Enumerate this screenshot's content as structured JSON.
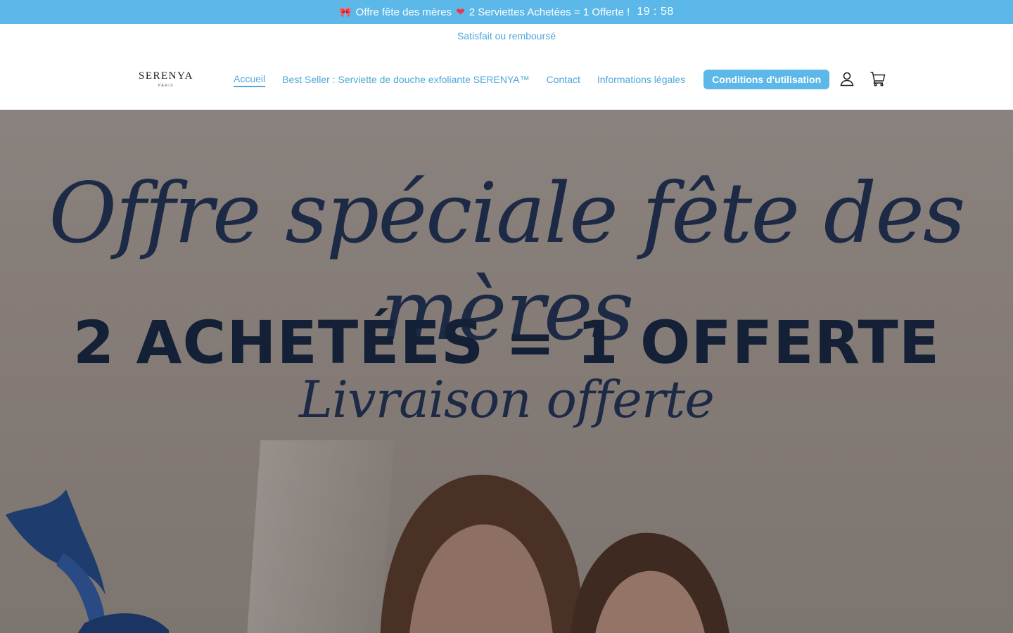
{
  "announcement": {
    "text_before": "Offre fête des mères",
    "text_after": " 2 Serviettes Achetées = 1 Offerte !",
    "timer": "19 : 58",
    "bow_icon": "ribbon-icon",
    "heart_icon": "heart-icon"
  },
  "sub_announcement": "Satisfait ou remboursé",
  "header": {
    "logo_brand": "SERENYA",
    "logo_city": "PARIS",
    "nav": [
      {
        "label": "Accueil"
      },
      {
        "label": "Best Seller : Serviette de douche exfoliante SERENYA™"
      },
      {
        "label": "Contact"
      },
      {
        "label": "Informations légales"
      },
      {
        "label": "Conditions d'utilisation"
      }
    ],
    "account_icon": "user-icon",
    "cart_icon": "cart-icon"
  },
  "hero": {
    "line1": "Offre spéciale fête des mères",
    "line2": "2 ACHETÉES = 1 OFFERTE",
    "line3": "Livraison offerte"
  },
  "colors": {
    "accent": "#5cb8e8",
    "link": "#4fa7d9",
    "hero_text": "#1d2a45",
    "hero_bg": "#857c77"
  }
}
